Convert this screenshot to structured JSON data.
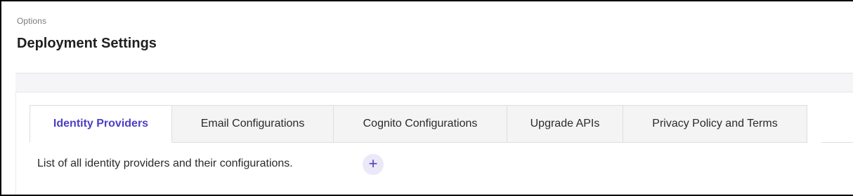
{
  "header": {
    "breadcrumb": "Options",
    "title": "Deployment Settings"
  },
  "tabs": [
    {
      "label": "Identity Providers",
      "active": true
    },
    {
      "label": "Email Configurations",
      "active": false
    },
    {
      "label": "Cognito Configurations",
      "active": false
    },
    {
      "label": "Upgrade APIs",
      "active": false
    },
    {
      "label": "Privacy Policy and Terms",
      "active": false
    }
  ],
  "content": {
    "description": "List of all identity providers and their configurations.",
    "add_icon": "plus-icon"
  },
  "colors": {
    "accent": "#4a3fc4",
    "add_button_bg": "#ebe9f7",
    "tab_inactive_bg": "#f4f4f5"
  }
}
